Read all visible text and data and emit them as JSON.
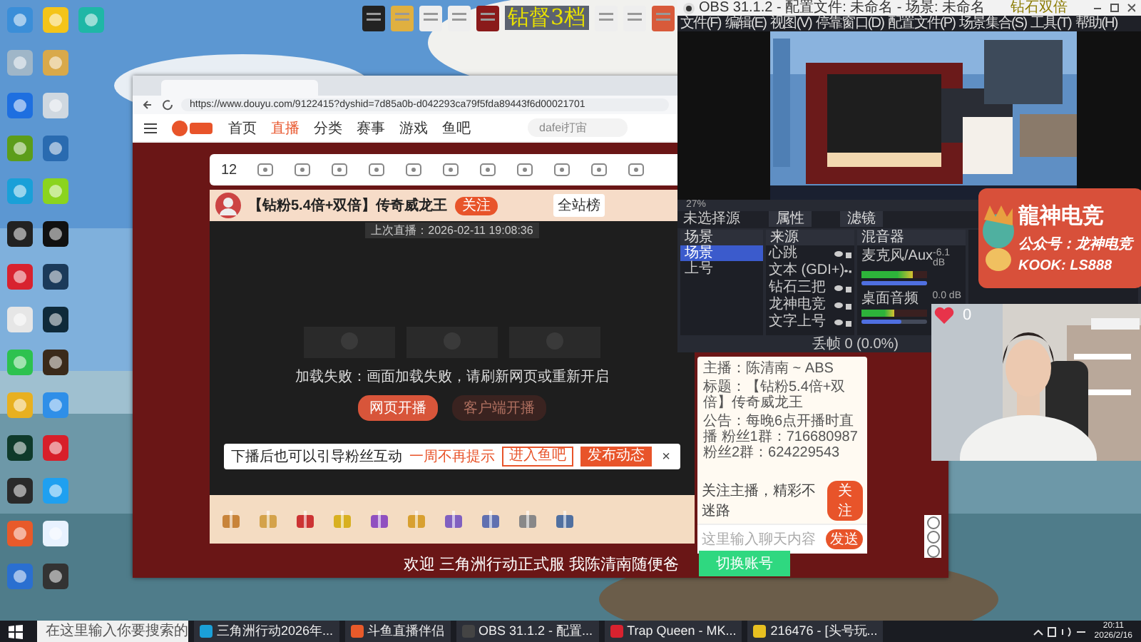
{
  "desktop": {
    "wallpaper": {
      "kind": "picture"
    },
    "icon_rows": [
      [
        {
          "color": "#3b8ed8"
        },
        {
          "color": "#f4c419"
        },
        {
          "color": "#1fb7a6"
        }
      ],
      [
        {
          "color": "#9fb6c8"
        },
        {
          "color": "#d9a94a"
        }
      ],
      [
        {
          "color": "#1e6fe0"
        },
        {
          "color": "#cfd8e0"
        }
      ],
      [
        {
          "color": "#5c9d1a"
        },
        {
          "color": "#2a6bb0"
        }
      ],
      [
        {
          "color": "#1aa0d8"
        },
        {
          "color": "#8bd41e"
        }
      ],
      [
        {
          "color": "#222222"
        },
        {
          "color": "#111111"
        }
      ],
      [
        {
          "color": "#d8222f"
        },
        {
          "color": "#1b3a5a"
        }
      ],
      [
        {
          "color": "#e6e6e6"
        },
        {
          "color": "#0f2a3a"
        }
      ],
      [
        {
          "color": "#2dc24f"
        },
        {
          "color": "#3a2a1a"
        }
      ],
      [
        {
          "color": "#e8b020"
        },
        {
          "color": "#2f8fe8"
        }
      ],
      [
        {
          "color": "#0f3a2a"
        },
        {
          "color": "#d81f2a"
        }
      ],
      [
        {
          "color": "#2a2a2a"
        },
        {
          "color": "#1fa0f0"
        }
      ],
      [
        {
          "color": "#e85a2a"
        },
        {
          "color": "#e8f2ff"
        }
      ],
      [
        {
          "color": "#2a6fd0"
        },
        {
          "color": "#333333"
        }
      ]
    ],
    "top_icons": [
      {
        "color": "#222222"
      },
      {
        "color": "#e0b040"
      },
      {
        "color": "#eeeeee"
      },
      {
        "color": "#eeeeee"
      },
      {
        "color": "#8a1a1a"
      },
      {
        "color": "#eeeeee"
      },
      {
        "color": "#eeeeee"
      },
      {
        "color": "#d85a3a"
      }
    ]
  },
  "stream_overlay": {
    "left_text": "钻督3档",
    "right_text": "钻石双倍"
  },
  "browser": {
    "url": "https://www.douyu.com/9122415?dyshid=7d85a0b-d042293ca79f5fda89443f6d00021701",
    "nav": [
      {
        "label": "首页",
        "selected": false
      },
      {
        "label": "直播",
        "selected": true
      },
      {
        "label": "分类",
        "selected": false
      },
      {
        "label": "赛事",
        "selected": false
      },
      {
        "label": "游戏",
        "selected": false
      },
      {
        "label": "鱼吧",
        "selected": false
      }
    ],
    "search_placeholder": "dafei打宙",
    "toolbar_count": "12",
    "room_title": "【钻粉5.4倍+双倍】传奇威龙王",
    "follow_label": "关注",
    "rank_label": "全站榜",
    "last_live": "上次直播：2026-02-11 19:08:36",
    "load_error": "加载失败：画面加载失败，请刷新网页或重新开启",
    "buttons": [
      {
        "label": "网页开播",
        "kind": "primary"
      },
      {
        "label": "客户端开播",
        "kind": "secondary"
      }
    ],
    "notice": {
      "text": "下播后也可以引导粉丝互动",
      "link": "一周不再提示",
      "actions": [
        {
          "label": "进入鱼吧",
          "kind": "secondary"
        },
        {
          "label": "发布动态",
          "kind": "primary"
        }
      ],
      "close": "×"
    },
    "welcome": "欢迎 三角洲行动正式服 我陈清南随便爸",
    "switch_account": "切换账号",
    "chat": {
      "lines": [
        "主播：陈清南 ~ ABS",
        "标题：【钻粉5.4倍+双倍】传奇威龙王",
        "公告：每晚6点开播时直播 粉丝1群：716680987 粉丝2群：624229543"
      ],
      "follow_hint": "关注主播，精彩不迷路",
      "follow_button": "关注",
      "placeholder": "这里输入聊天内容",
      "send": "发送"
    }
  },
  "obs": {
    "title": "OBS 31.1.2 - 配置文件: 未命名 - 场景: 未命名",
    "menu": [
      "文件(F)",
      "编辑(E)",
      "视图(V)",
      "停靠窗口(D)",
      "配置文件(P)",
      "场景集合(S)",
      "工具(T)",
      "帮助(H)"
    ],
    "zoom": "27%",
    "no_source": "未选择源",
    "properties": "属性",
    "filters": "滤镜",
    "scenes": {
      "title": "场景",
      "items": [
        {
          "label": "场景",
          "selected": true
        },
        {
          "label": "上号",
          "selected": false
        }
      ]
    },
    "sources": {
      "title": "来源",
      "items": [
        "心跳",
        "文本 (GDI+)",
        "钻石三把",
        "龙神电竞",
        "文字上号"
      ]
    },
    "mixer": {
      "title": "混音器",
      "channels": [
        {
          "name": "麦克风/Aux",
          "reading": "-6.1 dB",
          "level": 0.78,
          "volume": {
            "level": 1
          }
        },
        {
          "name": "桌面音频",
          "reading": "0.0 dB",
          "level": 0.5,
          "volume": {
            "level": 0.6
          }
        }
      ]
    },
    "status": "丢帧 0 (0.0%)"
  },
  "promo": {
    "brand": "龍神电竞",
    "account": "公众号：龙神电竞",
    "kook": "KOOK: LS888"
  },
  "webcam": {
    "kind": "picture",
    "heart_count": "0"
  },
  "taskbar": {
    "search_placeholder": "在这里输入你要搜索的",
    "items": [
      {
        "label": "三角洲行动2026年...",
        "color": "#1aa0d8"
      },
      {
        "label": "斗鱼直播伴侣",
        "color": "#e85a2a"
      },
      {
        "label": "OBS 31.1.2 - 配置...",
        "color": "#444444"
      },
      {
        "label": "Trap Queen - MK...",
        "color": "#d8222f"
      },
      {
        "label": "216476 - [头号玩...",
        "color": "#e8c020"
      }
    ],
    "time": "20:11",
    "date": "2026/2/16"
  }
}
